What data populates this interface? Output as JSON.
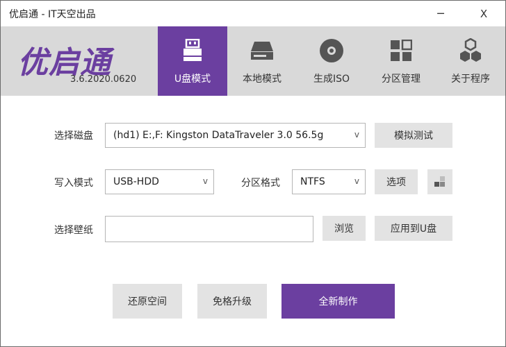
{
  "window": {
    "title": "优启通 - IT天空出品",
    "minimize_glyph": "─",
    "close_glyph": "X"
  },
  "header": {
    "logo": "优启通",
    "version": "3.6.2020.0620",
    "tabs": [
      {
        "label": "U盘模式",
        "icon": "usb-drive-icon",
        "active": true
      },
      {
        "label": "本地模式",
        "icon": "hard-disk-icon",
        "active": false
      },
      {
        "label": "生成ISO",
        "icon": "disc-icon",
        "active": false
      },
      {
        "label": "分区管理",
        "icon": "partition-grid-icon",
        "active": false
      },
      {
        "label": "关于程序",
        "icon": "hexagon-cluster-icon",
        "active": false
      }
    ],
    "accent_color": "#6b3fa0",
    "header_bg": "#d9d9d9"
  },
  "form": {
    "disk_label": "选择磁盘",
    "disk_value": "(hd1) E:,F: Kingston DataTraveler 3.0 56.5g",
    "simulate_button": "模拟测试",
    "write_mode_label": "写入模式",
    "write_mode_value": "USB-HDD",
    "partition_format_label": "分区格式",
    "partition_format_value": "NTFS",
    "options_button": "选项",
    "wallpaper_label": "选择壁纸",
    "wallpaper_value": "",
    "browse_button": "浏览",
    "apply_button": "应用到U盘",
    "dropdown_chevron": "v"
  },
  "actions": {
    "restore_button": "还原空间",
    "upgrade_button": "免格升级",
    "create_button": "全新制作"
  }
}
